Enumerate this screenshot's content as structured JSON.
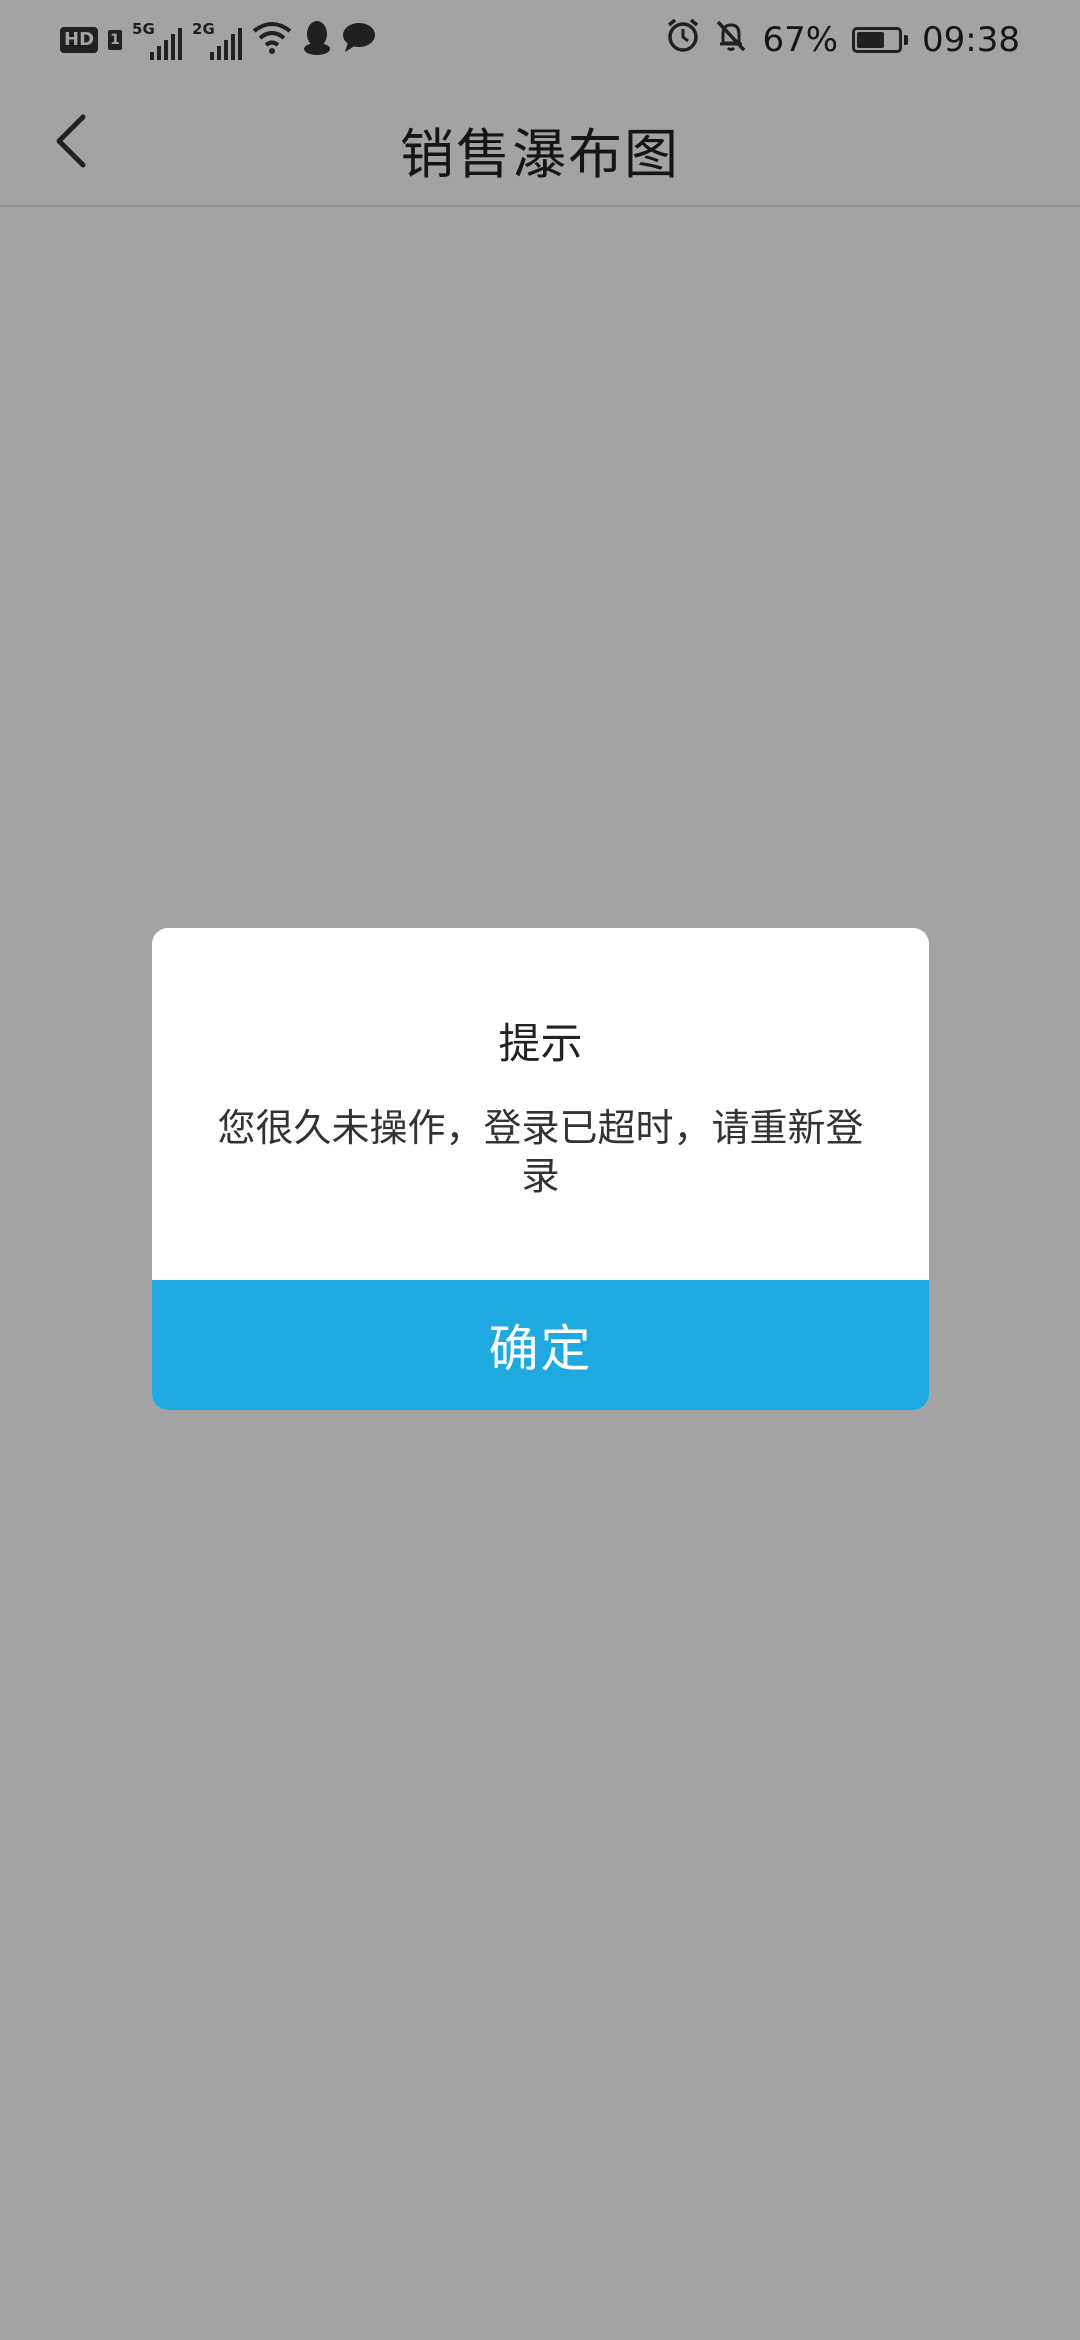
{
  "status_bar": {
    "hd_label": "HD",
    "sim1_label": "1",
    "network1": "5G",
    "network2": "2G",
    "battery_percent": "67%",
    "battery_level": 0.67,
    "time": "09:38",
    "icons": [
      "hd-icon",
      "signal-5g-icon",
      "signal-2g-icon",
      "wifi-icon",
      "qq-icon",
      "chat-bubble-icon",
      "alarm-icon",
      "mute-bell-icon",
      "battery-icon"
    ]
  },
  "header": {
    "title": "销售瀑布图",
    "back_icon": "chevron-left-icon"
  },
  "dialog": {
    "title": "提示",
    "message": "您很久未操作，登录已超时，请重新登录",
    "confirm_label": "确定"
  },
  "colors": {
    "accent": "#1fa9e1",
    "overlay": "#a6a6a6",
    "text": "#222222"
  }
}
